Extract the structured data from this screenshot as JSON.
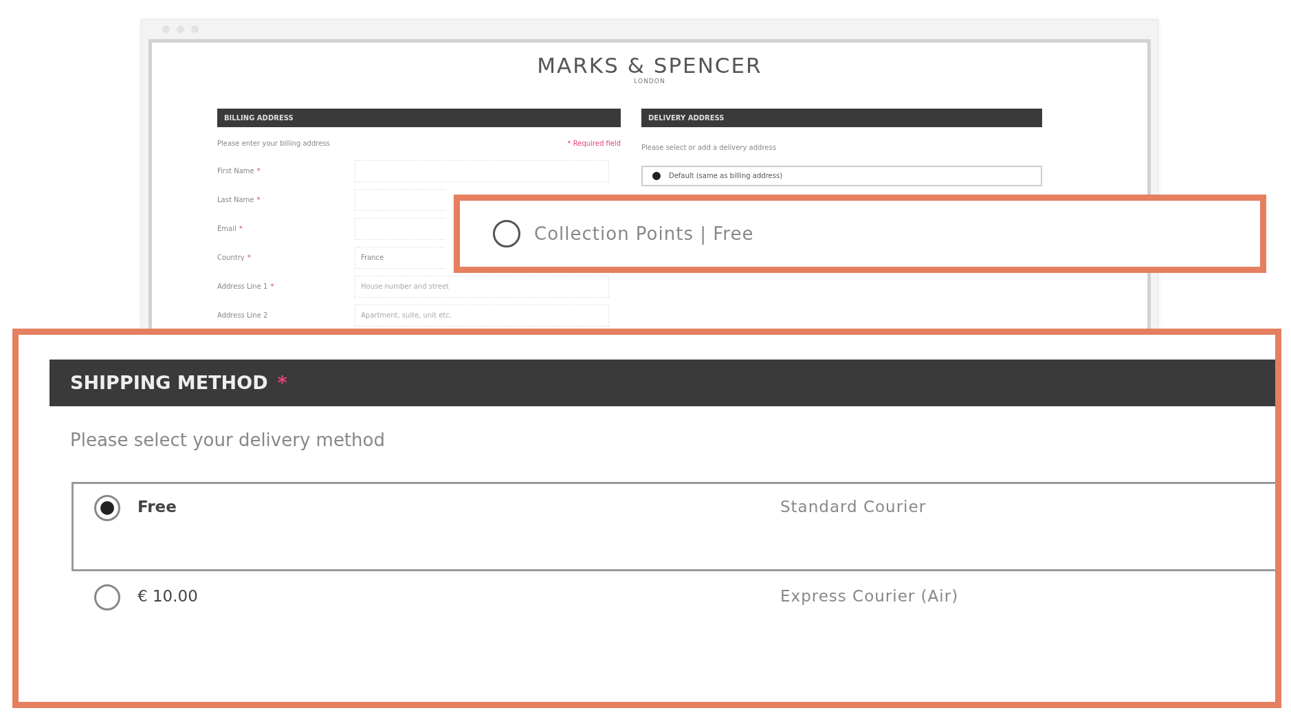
{
  "page": {
    "logo": "MARKS & SPENCER",
    "logo_subtitle": "LONDON",
    "billing": {
      "title": "BILLING ADDRESS",
      "intro": "Please enter your billing address",
      "required_note": "* Required field",
      "fields": [
        {
          "label": "First Name",
          "mark": "*"
        },
        {
          "label": "Last Name",
          "mark": "*"
        },
        {
          "label": "Email",
          "mark": "*"
        },
        {
          "label": "Country",
          "mark": "*",
          "value": "France"
        },
        {
          "label": "Address Line 1",
          "mark": "*",
          "placeholder": "House number and street"
        },
        {
          "label": "Address Line 2",
          "placeholder": "Apartment, suite, unit etc."
        }
      ]
    },
    "delivery": {
      "title": "DELIVERY ADDRESS",
      "intro": "Please select or add a delivery address",
      "options": [
        {
          "label": "Default (same as billing address)",
          "selected": true
        }
      ]
    }
  },
  "collection_callout": {
    "label": "Collection Points | Free",
    "selected": false
  },
  "shipping_callout": {
    "title": "SHIPPING METHOD",
    "mark": "*",
    "intro": "Please select your delivery method",
    "options": [
      {
        "price": "Free",
        "service": "Standard Courier",
        "selected": true
      },
      {
        "price": "€ 10.00",
        "service": "Express Courier (Air)",
        "selected": false
      }
    ]
  }
}
